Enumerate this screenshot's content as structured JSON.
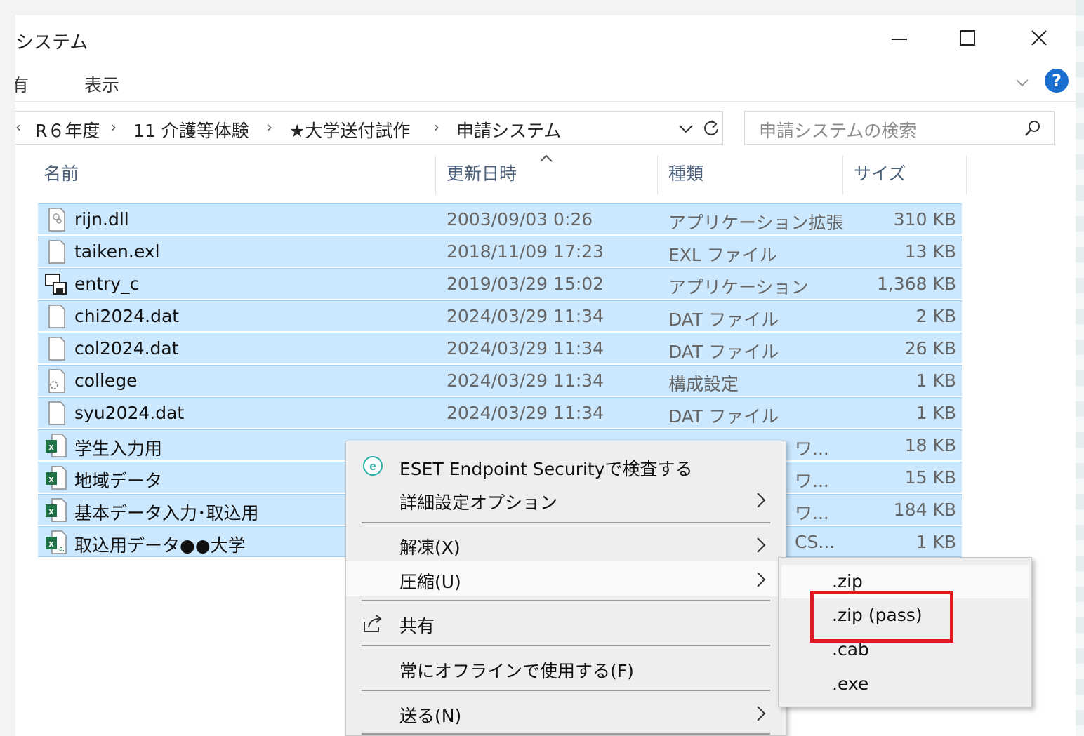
{
  "window": {
    "title": "システム",
    "controls": {
      "minimize": "minimize",
      "maximize": "maximize",
      "close": "close"
    }
  },
  "ribbon": {
    "tabs": [
      "有",
      "表示"
    ],
    "help_label": "?"
  },
  "address": {
    "back_glyph": "‹",
    "crumbs": [
      "R６年度",
      "11 介護等体験",
      "★大学送付試作",
      "申請システム"
    ],
    "separator": "›"
  },
  "search": {
    "placeholder": "申請システムの検索"
  },
  "columns": {
    "name": "名前",
    "date": "更新日時",
    "type": "種類",
    "size": "サイズ"
  },
  "files": [
    {
      "name": "rijn.dll",
      "date": "2003/09/03 0:26",
      "type": "アプリケーション拡張",
      "size": "310 KB",
      "icon": "dll-file-icon"
    },
    {
      "name": "taiken.exl",
      "date": "2018/11/09 17:23",
      "type": "EXL ファイル",
      "size": "13 KB",
      "icon": "generic-file-icon"
    },
    {
      "name": "entry_c",
      "date": "2019/03/29 15:02",
      "type": "アプリケーション",
      "size": "1,368 KB",
      "icon": "application-icon"
    },
    {
      "name": "chi2024.dat",
      "date": "2024/03/29 11:34",
      "type": "DAT ファイル",
      "size": "2 KB",
      "icon": "generic-file-icon"
    },
    {
      "name": "col2024.dat",
      "date": "2024/03/29 11:34",
      "type": "DAT ファイル",
      "size": "26 KB",
      "icon": "generic-file-icon"
    },
    {
      "name": "college",
      "date": "2024/03/29 11:34",
      "type": "構成設定",
      "size": "1 KB",
      "icon": "config-file-icon"
    },
    {
      "name": "syu2024.dat",
      "date": "2024/03/29 11:34",
      "type": "DAT ファイル",
      "size": "1 KB",
      "icon": "generic-file-icon"
    },
    {
      "name": "学生入力用",
      "date": "",
      "type": "ワ...",
      "size": "18 KB",
      "icon": "excel-file-icon"
    },
    {
      "name": "地域データ",
      "date": "",
      "type": "ワ...",
      "size": "15 KB",
      "icon": "excel-file-icon"
    },
    {
      "name": "基本データ入力･取込用",
      "date": "",
      "type": "ワ...",
      "size": "184 KB",
      "icon": "excel-file-icon"
    },
    {
      "name": "取込用データ●●大学",
      "date": "",
      "type": "CS...",
      "size": "1 KB",
      "icon": "excel-csv-file-icon"
    }
  ],
  "context_menu": {
    "items": [
      {
        "label": "ESET Endpoint Securityで検査する",
        "icon": "eset-icon"
      },
      {
        "label": "詳細設定オプション",
        "submenu": true
      },
      {
        "label": "解凍(X)",
        "submenu": true
      },
      {
        "label": "圧縮(U)",
        "submenu": true,
        "highlighted": true
      },
      {
        "label": "共有",
        "icon": "share-icon"
      },
      {
        "label": "常にオフラインで使用する(F)"
      },
      {
        "label": "送る(N)",
        "submenu": true
      }
    ]
  },
  "compress_submenu": {
    "items": [
      ".zip",
      ".zip (pass)",
      ".cab",
      ".exe"
    ],
    "highlighted": ".zip",
    "annotated": ".zip (pass)",
    "annotation_color": "#e01822"
  },
  "colors": {
    "selection_bg": "#cce8ff",
    "selection_border": "#99d1ff",
    "help_blue": "#1a6fd1",
    "excel_green": "#1e7145"
  }
}
